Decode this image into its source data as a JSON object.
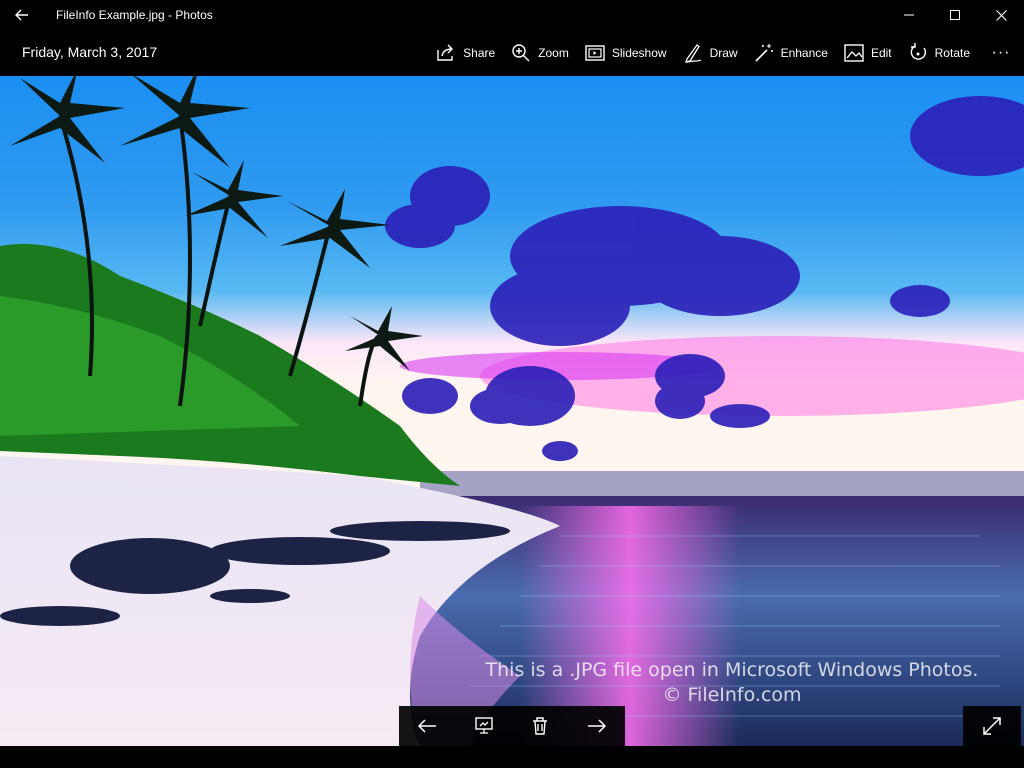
{
  "window": {
    "title": "FileInfo Example.jpg - Photos"
  },
  "toolbar": {
    "date": "Friday, March 3, 2017",
    "items": [
      {
        "label": "Share",
        "icon": "share-icon"
      },
      {
        "label": "Zoom",
        "icon": "zoom-icon"
      },
      {
        "label": "Slideshow",
        "icon": "slideshow-icon"
      },
      {
        "label": "Draw",
        "icon": "draw-icon"
      },
      {
        "label": "Enhance",
        "icon": "enhance-icon"
      },
      {
        "label": "Edit",
        "icon": "edit-icon"
      },
      {
        "label": "Rotate",
        "icon": "rotate-icon"
      }
    ],
    "more": "···"
  },
  "photo": {
    "watermark_line1": "This is a .JPG file open in Microsoft Windows Photos.",
    "watermark_line2": "© FileInfo.com"
  },
  "colors": {
    "chrome": "#000000",
    "sky": "#1e88f0",
    "sand": "#f2ecf6"
  }
}
